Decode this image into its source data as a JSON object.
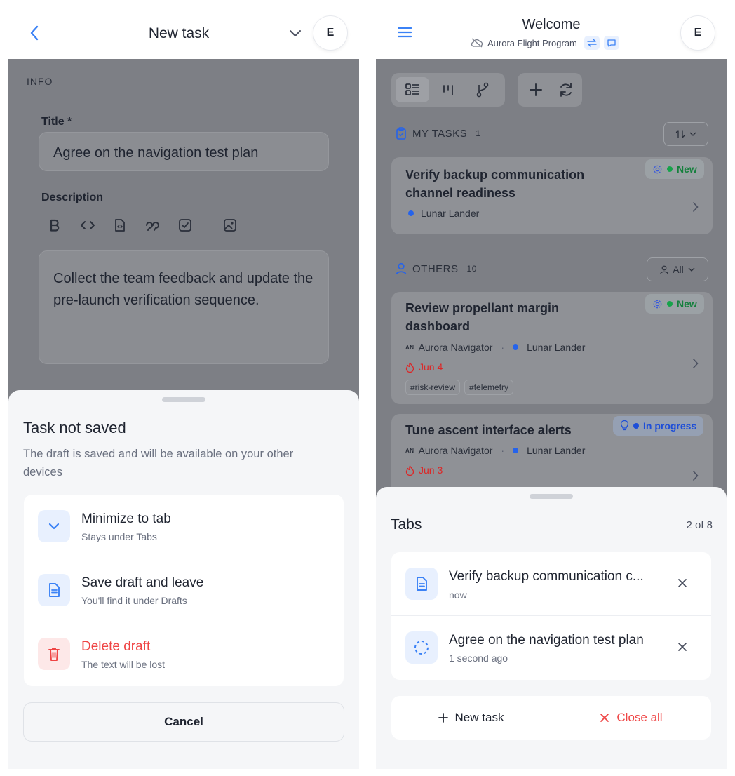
{
  "left": {
    "header": {
      "title": "New task",
      "avatar": "E",
      "back_icon": "chevron-left-icon",
      "expand_icon": "chevron-down-icon"
    },
    "form": {
      "section_label": "INFO",
      "title_label": "Title *",
      "title_value": "Agree on the navigation test plan",
      "description_label": "Description",
      "toolbar": [
        "bold-icon",
        "code-icon",
        "code-block-icon",
        "quote-icon",
        "checkbox-icon",
        "image-icon"
      ],
      "description_value": "Collect the team feedback and update the pre-launch verification sequence."
    },
    "sheet": {
      "title": "Task not saved",
      "subtitle": "The draft is saved and will be available on your other devices",
      "options": [
        {
          "title": "Minimize to tab",
          "subtitle": "Stays under Tabs",
          "icon": "chevron-down-icon"
        },
        {
          "title": "Save draft and leave",
          "subtitle": "You'll find it under Drafts",
          "icon": "document-icon"
        },
        {
          "title": "Delete draft",
          "subtitle": "The text will be lost",
          "icon": "trash-icon"
        }
      ],
      "cancel_label": "Cancel"
    }
  },
  "right": {
    "header": {
      "title": "Welcome",
      "subtitle": "Aurora Flight Program",
      "avatar": "E",
      "menu_icon": "menu-icon",
      "sync_off_icon": "cloud-off-icon",
      "swap_icon": "swap-icon",
      "chat_icon": "chat-icon"
    },
    "toolbar": [
      "list-view-icon",
      "board-view-icon",
      "branch-icon",
      "plus-icon",
      "refresh-icon"
    ],
    "my_tasks": {
      "label": "MY TASKS",
      "count": "1",
      "sort_icon": "sort-icon",
      "items": [
        {
          "title": "Verify backup communication channel readiness",
          "project": "Lunar Lander",
          "status": "New"
        }
      ]
    },
    "others": {
      "label": "OTHERS",
      "count": "10",
      "filter_label": "All",
      "items": [
        {
          "title": "Review propellant margin dashboard",
          "assignee_badge": "AN",
          "assignee": "Aurora Navigator",
          "sep": "·",
          "project": "Lunar Lander",
          "due": "Jun 4",
          "tags": [
            "#risk-review",
            "#telemetry"
          ],
          "status": "New"
        },
        {
          "title": "Tune ascent interface alerts",
          "assignee_badge": "AN",
          "assignee": "Aurora Navigator",
          "sep": "·",
          "project": "Lunar Lander",
          "due": "Jun 3",
          "status": "In progress"
        }
      ]
    },
    "tabs_sheet": {
      "title": "Tabs",
      "count": "2 of 8",
      "tabs": [
        {
          "title": "Verify backup communication c...",
          "time": "now",
          "icon": "document-icon"
        },
        {
          "title": "Agree on the navigation test plan",
          "time": "1 second ago",
          "icon": "dashed-circle-icon"
        }
      ],
      "new_task_label": "New task",
      "close_all_label": "Close all"
    }
  },
  "colors": {
    "accent": "#3b82f6",
    "danger": "#ef4444",
    "success": "#22c55e",
    "overlay": "#7d7f85"
  }
}
